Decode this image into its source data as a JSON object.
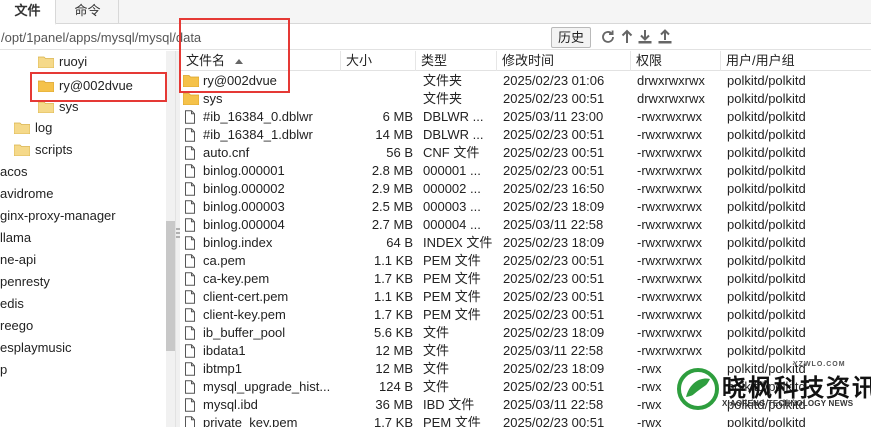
{
  "tabs": [
    {
      "label": "文件",
      "active": true
    },
    {
      "label": "命令",
      "active": false
    }
  ],
  "path_bar": {
    "value": "/opt/1panel/apps/mysql/mysql/data",
    "history_label": "历史",
    "icons": [
      "refresh-icon",
      "up-arrow-icon",
      "download-icon",
      "upload-icon"
    ]
  },
  "tree": {
    "items": [
      {
        "label": "ruoyi",
        "has_icon": true
      },
      {
        "label": "ry@002dvue",
        "has_icon": true,
        "highlighted": true
      },
      {
        "label": "sys",
        "has_icon": true
      },
      {
        "label": "log",
        "has_icon": true
      },
      {
        "label": "scripts",
        "has_icon": true
      },
      {
        "label": "acos",
        "has_icon": false
      },
      {
        "label": "avidrome",
        "has_icon": false
      },
      {
        "label": "ginx-proxy-manager",
        "has_icon": false
      },
      {
        "label": "llama",
        "has_icon": false
      },
      {
        "label": "ne-api",
        "has_icon": false
      },
      {
        "label": "penresty",
        "has_icon": false
      },
      {
        "label": "edis",
        "has_icon": false
      },
      {
        "label": "reego",
        "has_icon": false
      },
      {
        "label": "esplaymusic",
        "has_icon": false
      },
      {
        "label": "p",
        "has_icon": false
      }
    ]
  },
  "list": {
    "columns": {
      "name": "文件名",
      "size": "大小",
      "type": "类型",
      "mtime": "修改时间",
      "perm": "权限",
      "owner": "用户/用户组"
    },
    "rows": [
      {
        "name": "ry@002dvue",
        "icon": "folder-icon",
        "size": "",
        "type": "文件夹",
        "mtime": "2025/02/23 01:06",
        "perm": "drwxrwxrwx",
        "owner": "polkitd/polkitd"
      },
      {
        "name": "sys",
        "icon": "folder-icon",
        "size": "",
        "type": "文件夹",
        "mtime": "2025/02/23 00:51",
        "perm": "drwxrwxrwx",
        "owner": "polkitd/polkitd"
      },
      {
        "name": "#ib_16384_0.dblwr",
        "icon": "file-icon",
        "size": "6 MB",
        "type": "DBLWR ...",
        "mtime": "2025/03/11 23:00",
        "perm": "-rwxrwxrwx",
        "owner": "polkitd/polkitd"
      },
      {
        "name": "#ib_16384_1.dblwr",
        "icon": "file-icon",
        "size": "14 MB",
        "type": "DBLWR ...",
        "mtime": "2025/02/23 00:51",
        "perm": "-rwxrwxrwx",
        "owner": "polkitd/polkitd"
      },
      {
        "name": "auto.cnf",
        "icon": "file-icon",
        "size": "56 B",
        "type": "CNF 文件",
        "mtime": "2025/02/23 00:51",
        "perm": "-rwxrwxrwx",
        "owner": "polkitd/polkitd"
      },
      {
        "name": "binlog.000001",
        "icon": "file-icon",
        "size": "2.8 MB",
        "type": "000001 ...",
        "mtime": "2025/02/23 00:51",
        "perm": "-rwxrwxrwx",
        "owner": "polkitd/polkitd"
      },
      {
        "name": "binlog.000002",
        "icon": "file-icon",
        "size": "2.9 MB",
        "type": "000002 ...",
        "mtime": "2025/02/23 16:50",
        "perm": "-rwxrwxrwx",
        "owner": "polkitd/polkitd"
      },
      {
        "name": "binlog.000003",
        "icon": "file-icon",
        "size": "2.5 MB",
        "type": "000003 ...",
        "mtime": "2025/02/23 18:09",
        "perm": "-rwxrwxrwx",
        "owner": "polkitd/polkitd"
      },
      {
        "name": "binlog.000004",
        "icon": "file-icon",
        "size": "2.7 MB",
        "type": "000004 ...",
        "mtime": "2025/03/11 22:58",
        "perm": "-rwxrwxrwx",
        "owner": "polkitd/polkitd"
      },
      {
        "name": "binlog.index",
        "icon": "file-icon",
        "size": "64 B",
        "type": "INDEX 文件",
        "mtime": "2025/02/23 18:09",
        "perm": "-rwxrwxrwx",
        "owner": "polkitd/polkitd"
      },
      {
        "name": "ca.pem",
        "icon": "file-icon",
        "size": "1.1 KB",
        "type": "PEM 文件",
        "mtime": "2025/02/23 00:51",
        "perm": "-rwxrwxrwx",
        "owner": "polkitd/polkitd"
      },
      {
        "name": "ca-key.pem",
        "icon": "file-icon",
        "size": "1.7 KB",
        "type": "PEM 文件",
        "mtime": "2025/02/23 00:51",
        "perm": "-rwxrwxrwx",
        "owner": "polkitd/polkitd"
      },
      {
        "name": "client-cert.pem",
        "icon": "file-icon",
        "size": "1.1 KB",
        "type": "PEM 文件",
        "mtime": "2025/02/23 00:51",
        "perm": "-rwxrwxrwx",
        "owner": "polkitd/polkitd"
      },
      {
        "name": "client-key.pem",
        "icon": "file-icon",
        "size": "1.7 KB",
        "type": "PEM 文件",
        "mtime": "2025/02/23 00:51",
        "perm": "-rwxrwxrwx",
        "owner": "polkitd/polkitd"
      },
      {
        "name": "ib_buffer_pool",
        "icon": "file-icon",
        "size": "5.6 KB",
        "type": "文件",
        "mtime": "2025/02/23 18:09",
        "perm": "-rwxrwxrwx",
        "owner": "polkitd/polkitd"
      },
      {
        "name": "ibdata1",
        "icon": "file-icon",
        "size": "12 MB",
        "type": "文件",
        "mtime": "2025/03/11 22:58",
        "perm": "-rwxrwxrwx",
        "owner": "polkitd/polkitd"
      },
      {
        "name": "ibtmp1",
        "icon": "file-icon",
        "size": "12 MB",
        "type": "文件",
        "mtime": "2025/02/23 18:09",
        "perm": "-rwx",
        "owner": "polkitd/polkitd"
      },
      {
        "name": "mysql_upgrade_hist...",
        "icon": "file-icon",
        "size": "124 B",
        "type": "文件",
        "mtime": "2025/02/23 00:51",
        "perm": "-rwx",
        "owner": "polkitd/polkitd"
      },
      {
        "name": "mysql.ibd",
        "icon": "file-icon",
        "size": "36 MB",
        "type": "IBD 文件",
        "mtime": "2025/03/11 22:58",
        "perm": "-rwx",
        "owner": "polkitd/polkitd"
      },
      {
        "name": "private_key.pem",
        "icon": "file-icon",
        "size": "1.7 KB",
        "type": "PEM 文件",
        "mtime": "2025/02/23 00:51",
        "perm": "-rwx",
        "owner": "polkitd/polkitd"
      }
    ]
  },
  "watermark": {
    "domain": "YZWLO.COM",
    "title": "晓枫科技资讯",
    "subtitle": "XIAOFENG TECHNOLOGY NEWS"
  },
  "colors": {
    "highlight": "#e53935",
    "folder": "#f5c24a",
    "logo_green": "#2e9e3e"
  }
}
